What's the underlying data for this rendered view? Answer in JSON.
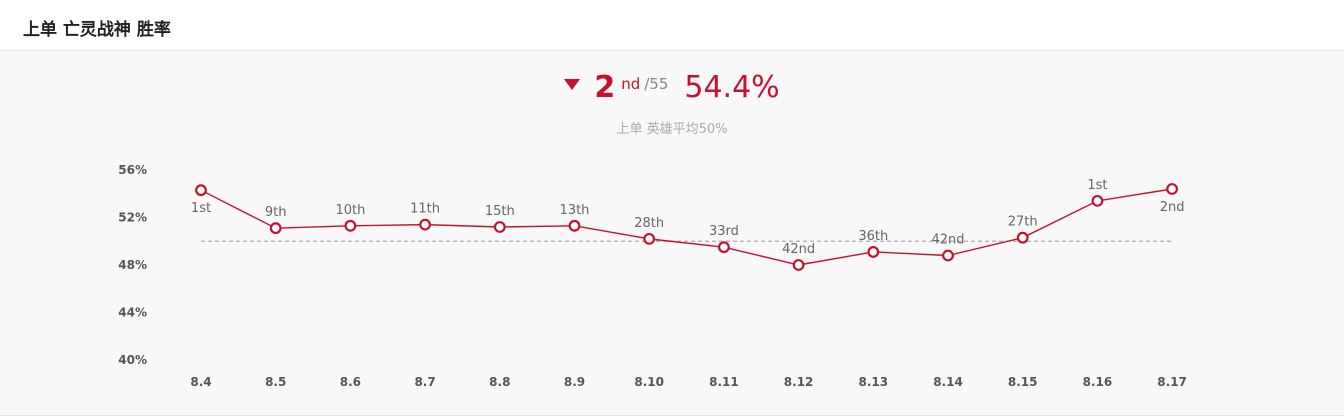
{
  "header": {
    "title": "上单 亡灵战神 胜率"
  },
  "summary": {
    "rank": "2",
    "rank_suffix": "nd",
    "rank_total": "/55",
    "win_rate": "54.4%",
    "average_caption": "上单 英雄平均50%",
    "trend": "down",
    "trend_icon": "down-triangle-icon"
  },
  "colors": {
    "accent": "#c8102e",
    "grid_ref": "#aaaaaa"
  },
  "chart_data": {
    "type": "line",
    "title": "",
    "xlabel": "",
    "ylabel": "",
    "categories": [
      "8.4",
      "8.5",
      "8.6",
      "8.7",
      "8.8",
      "8.9",
      "8.10",
      "8.11",
      "8.12",
      "8.13",
      "8.14",
      "8.15",
      "8.16",
      "8.17"
    ],
    "series": [
      {
        "values": [
          54.3,
          51.1,
          51.3,
          51.4,
          51.2,
          51.3,
          50.2,
          49.5,
          48.0,
          49.1,
          48.8,
          50.3,
          53.4,
          54.4
        ],
        "point_labels": [
          "1st",
          "9th",
          "10th",
          "11th",
          "15th",
          "13th",
          "28th",
          "33rd",
          "42nd",
          "36th",
          "42nd",
          "27th",
          "1st",
          "2nd"
        ]
      }
    ],
    "reference_line": 50,
    "ylim": [
      40,
      56
    ],
    "yticks": [
      56,
      52,
      48,
      44,
      40
    ],
    "ytick_labels": [
      "56%",
      "52%",
      "48%",
      "44%",
      "40%"
    ],
    "grid": false
  }
}
